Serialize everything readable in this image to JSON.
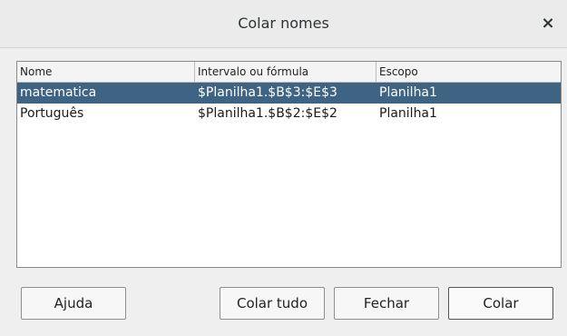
{
  "window": {
    "title": "Colar nomes",
    "close_glyph": "×"
  },
  "table": {
    "headers": [
      "Nome",
      "Intervalo ou fórmula",
      "Escopo"
    ],
    "rows": [
      {
        "name": "matematica",
        "range": "$Planilha1.$B$3:$E$3",
        "scope": "Planilha1",
        "selected": true
      },
      {
        "name": "Português",
        "range": "$Planilha1.$B$2:$E$2",
        "scope": "Planilha1",
        "selected": false
      }
    ]
  },
  "buttons": {
    "help": "Ajuda",
    "paste_all": "Colar tudo",
    "close": "Fechar",
    "paste": "Colar"
  },
  "colors": {
    "selection": "#3f6383"
  }
}
